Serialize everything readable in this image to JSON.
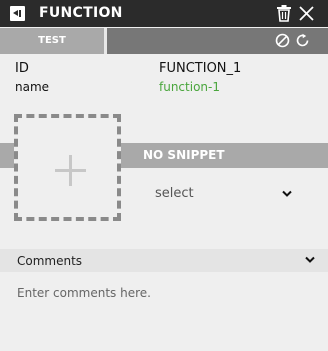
{
  "titlebar": {
    "title": "FUNCTION",
    "panel_icon": "collapse-panel-icon",
    "delete_icon": "trash-icon",
    "close_icon": "close-icon"
  },
  "tabs": {
    "test_label": "TEST",
    "disable_icon": "disable-icon",
    "reset_icon": "reset-icon"
  },
  "properties": [
    {
      "key": "ID",
      "value": "FUNCTION_1"
    },
    {
      "key": "name",
      "value": "function-1"
    }
  ],
  "snippet": {
    "status_label": "NO SNIPPET",
    "add_icon": "plus-icon"
  },
  "select": {
    "value": "select",
    "icon": "chevron-down-icon"
  },
  "comments": {
    "label": "Comments",
    "placeholder": "Enter comments here.",
    "value": ""
  },
  "colors": {
    "titlebar_bg": "#2b2b2b",
    "tab_active_bg": "#a9a9a9",
    "tab_bar_bg": "#777777",
    "name_value": "#4aa63d",
    "panel_bg": "#efefef"
  }
}
